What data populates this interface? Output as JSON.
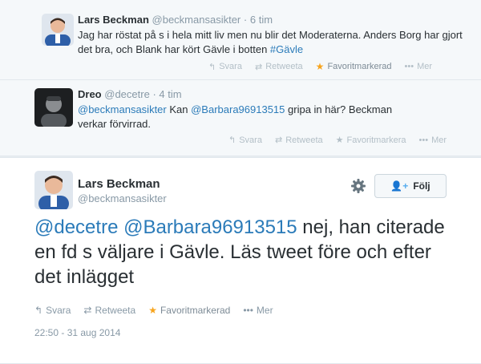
{
  "replies": [
    {
      "name": "Lars Beckman",
      "handle": "@beckmansasikter",
      "dot": "·",
      "time": "6 tim",
      "text_plain": "Jag har röstat på s i hela mitt liv men nu blir det Moderaterna. Anders Borg har gjort det bra, och Blank har kört Gävle i botten ",
      "hashtag": "#Gävle",
      "actions": {
        "reply": "Svara",
        "retweet": "Retweeta",
        "favorite": "Favoritmarkerad",
        "more": "Mer"
      }
    },
    {
      "name": "Dreo",
      "handle": "@decetre",
      "dot": "·",
      "time": "4 tim",
      "mention1": "@beckmansasikter",
      "text_mid": " Kan ",
      "mention2": "@Barbara96913515",
      "text_end": " gripa in här? Beckman verkar förvirrad.",
      "actions": {
        "reply": "Svara",
        "retweet": "Retweeta",
        "favorite": "Favoritmarkera",
        "more": "Mer"
      }
    }
  ],
  "main_tweet": {
    "name": "Lars Beckman",
    "handle": "@beckmansasikter",
    "follow_label": "Följ",
    "mention1": "@decetre",
    "mention2": "@Barbara96913515",
    "text_rest": " nej, han citerade en fd s väljare i Gävle. Läs tweet före och efter det inlägget",
    "actions": {
      "reply": "Svara",
      "retweet": "Retweeta",
      "favorite": "Favoritmarkerad",
      "more": "Mer"
    },
    "timestamp": "22:50 - 31 aug 2014"
  },
  "colors": {
    "link": "#2b7bb9",
    "star": "#f7a41d",
    "muted": "#8899a6"
  }
}
